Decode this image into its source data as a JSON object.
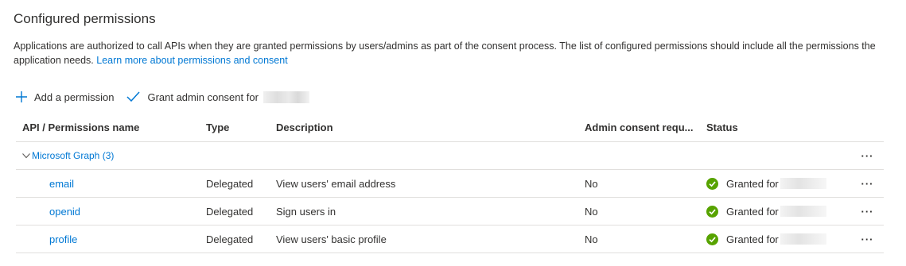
{
  "section": {
    "title": "Configured permissions",
    "description": "Applications are authorized to call APIs when they are granted permissions by users/admins as part of the consent process. The list of configured permissions should include all the permissions the application needs.",
    "learn_more": "Learn more about permissions and consent"
  },
  "toolbar": {
    "add_label": "Add a permission",
    "grant_label": "Grant admin consent for"
  },
  "table": {
    "headers": [
      "API / Permissions name",
      "Type",
      "Description",
      "Admin consent requ...",
      "Status"
    ],
    "group": {
      "label": "Microsoft Graph (3)",
      "more": "···"
    },
    "rows": [
      {
        "name": "email",
        "type": "Delegated",
        "description": "View users' email address",
        "admin": "No",
        "status": "Granted for",
        "more": "···"
      },
      {
        "name": "openid",
        "type": "Delegated",
        "description": "Sign users in",
        "admin": "No",
        "status": "Granted for",
        "more": "···"
      },
      {
        "name": "profile",
        "type": "Delegated",
        "description": "View users' basic profile",
        "admin": "No",
        "status": "Granted for",
        "more": "···"
      }
    ]
  },
  "colors": {
    "accent": "#0078d4",
    "success": "#57a300",
    "border": "#e1dfdd",
    "text": "#323130"
  },
  "icons": {
    "add": "plus-icon",
    "grant": "checkmark-icon",
    "expand": "chevron-down-icon",
    "granted": "check-circle-icon",
    "more": "more-icon"
  }
}
